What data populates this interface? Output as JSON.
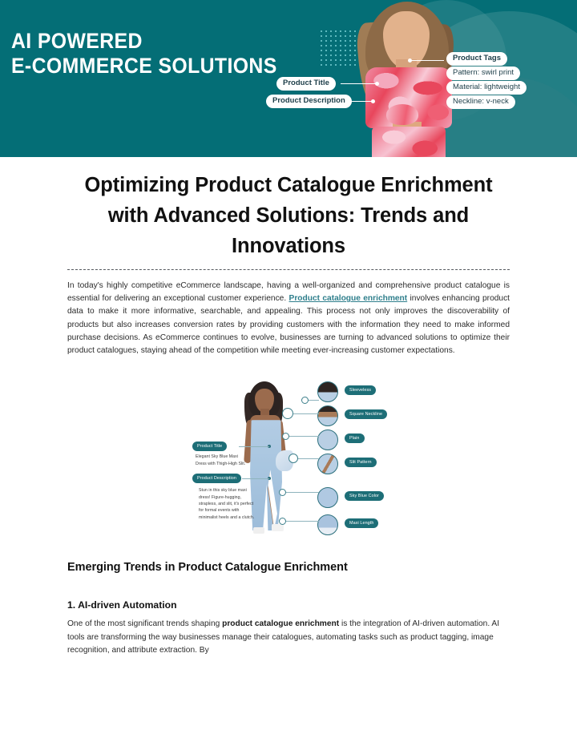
{
  "banner": {
    "headline": "AI POWERED\nE-COMMERCE SOLUTIONS",
    "brand_teal": "#046E76",
    "labels": {
      "product_title": "Product Title",
      "product_description": "Product Description",
      "product_tags": "Product Tags",
      "pattern": "Pattern: swirl print",
      "material": "Material: lightweight",
      "neckline": "Neckline: v-neck"
    }
  },
  "article": {
    "title": "Optimizing Product Catalogue Enrichment with Advanced Solutions: Trends and Innovations",
    "intro": {
      "part1": "In today's highly competitive eCommerce landscape, having a well-organized and comprehensive product catalogue is essential for delivering an exceptional customer experience. ",
      "link": "Product catalogue enrichment",
      "part2": " involves enhancing product data to make it more informative, searchable, and appealing. This process not only improves the discoverability of products but also increases conversion rates by providing customers with the information they need to make informed purchase decisions. As eCommerce continues to evolve, businesses are turning to advanced solutions to optimize their product catalogues, staying ahead of the competition while meeting ever-increasing customer expectations."
    }
  },
  "figure": {
    "left_tags": {
      "product_title": "Product Title",
      "product_title_text": "Elegant Sky Blue Maxi\nDress with Thigh-High Slit.",
      "product_description": "Product Description",
      "product_description_text": "Stun in this sky blue maxi\ndress! Figure-hugging,\nstrapless, and slit, it's perfect\nfor formal events with\nminimalist heels and a clutch."
    },
    "right_tags": [
      "Sleeveless",
      "Square Neckline",
      "Plain",
      "Slit Pattern",
      "Sky Blue Color",
      "Maxi Length"
    ],
    "tag_color": "#1d6e77"
  },
  "section": {
    "heading": "Emerging Trends in Product Catalogue Enrichment",
    "subheading": "1. AI-driven Automation",
    "paragraph": {
      "part1": "One of the most significant trends shaping ",
      "strong": "product catalogue enrichment",
      "part2": " is the integration of AI-driven automation. AI tools are transforming the way businesses manage their catalogues, automating tasks such as product tagging, image recognition, and attribute extraction. By"
    }
  }
}
